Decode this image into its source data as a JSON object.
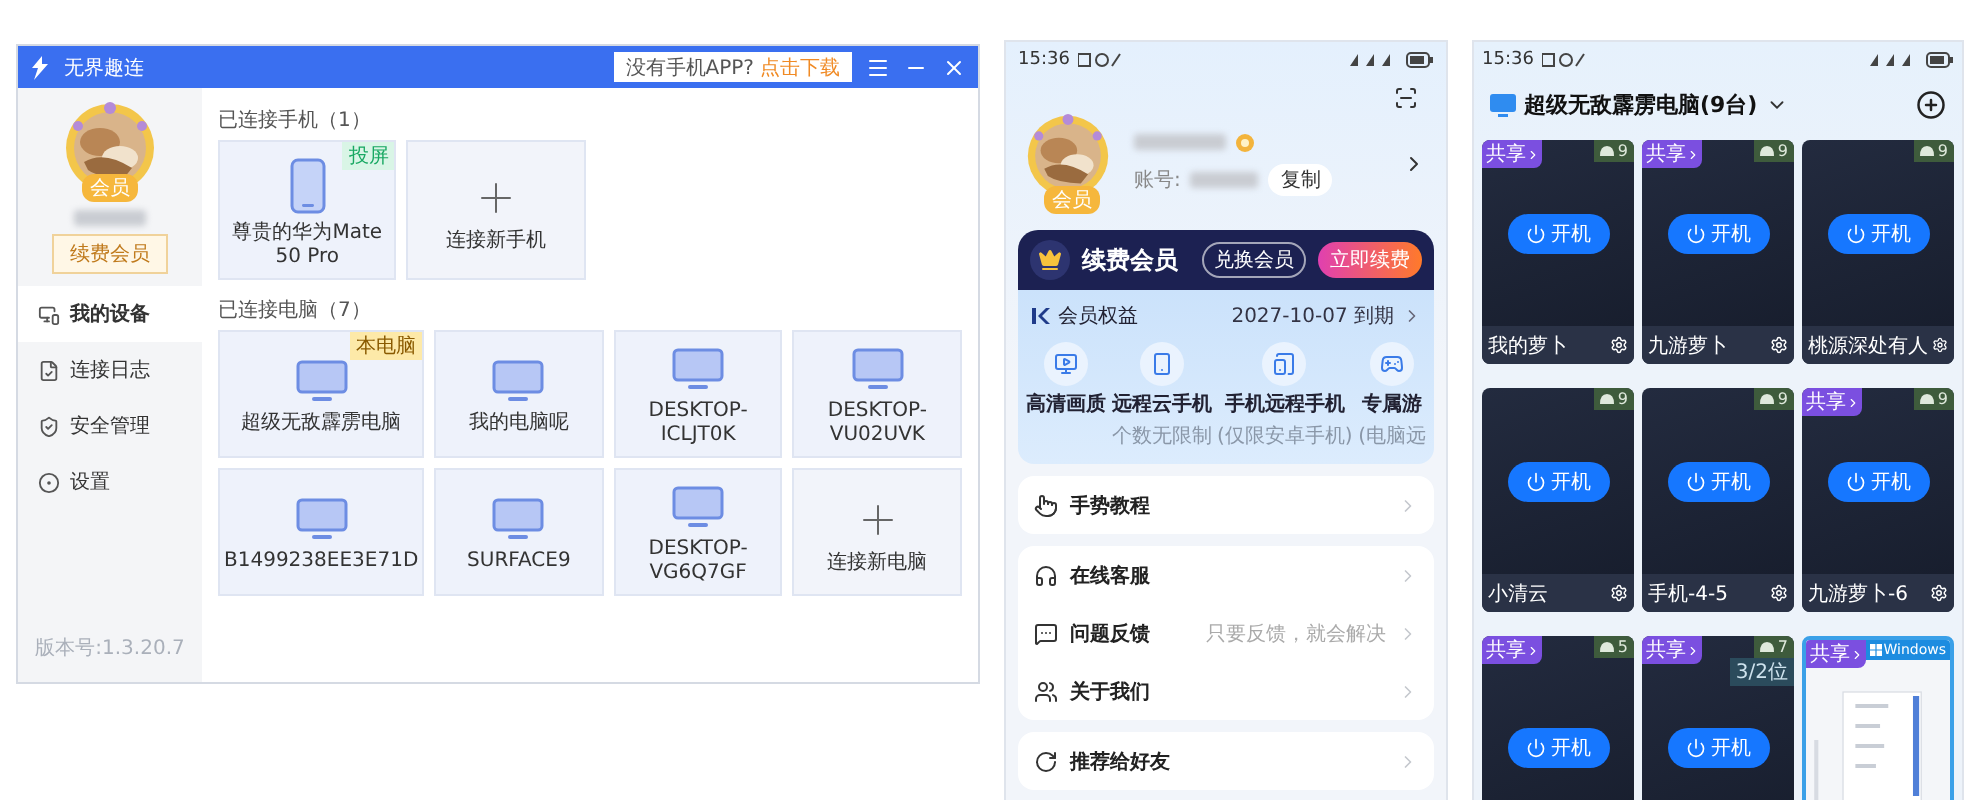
{
  "desktop_app": {
    "title": "无界趣连",
    "download_prompt": "没有手机APP?",
    "download_link": "点击下载",
    "member_badge": "会员",
    "renew_button": "续费会员",
    "nav": [
      {
        "label": "我的设备",
        "selected": true
      },
      {
        "label": "连接日志",
        "selected": false
      },
      {
        "label": "安全管理",
        "selected": false
      },
      {
        "label": "设置",
        "selected": false
      }
    ],
    "version": "版本号:1.3.20.7",
    "sections": [
      {
        "title": "已连接手机（1）",
        "devices": [
          {
            "kind": "phone",
            "name": "尊贵的华为Mate 50 Pro",
            "tag": {
              "kind": "cast",
              "text": "投屏"
            }
          },
          {
            "kind": "add",
            "name": "连接新手机"
          }
        ]
      },
      {
        "title": "已连接电脑（7）",
        "devices": [
          {
            "kind": "computer",
            "name": "超级无敌霹雳电脑",
            "tag": {
              "kind": "local",
              "text": "本电脑"
            }
          },
          {
            "kind": "computer",
            "name": "我的电脑呢"
          },
          {
            "kind": "computer",
            "name": "DESKTOP-ICLJT0K"
          },
          {
            "kind": "computer",
            "name": "DESKTOP-VU02UVK"
          },
          {
            "kind": "computer",
            "name": "B1499238EE3E71D"
          },
          {
            "kind": "computer",
            "name": "SURFACE9"
          },
          {
            "kind": "computer",
            "name": "DESKTOP-VG6Q7GF"
          },
          {
            "kind": "add",
            "name": "连接新电脑"
          }
        ]
      }
    ]
  },
  "member_phone": {
    "status_time": "15:36",
    "member_badge": "会员",
    "account_label": "账号:",
    "copy_button": "复制",
    "renew_title": "续费会员",
    "redeem_button": "兑换会员",
    "renew_now_button": "立即续费",
    "benefits_title": "会员权益",
    "expiry": "2027-10-07 到期",
    "benefits": [
      {
        "title": "高清画质"
      },
      {
        "title": "远程云手机",
        "subtitle": "个数无限制"
      },
      {
        "title": "手机远程手机",
        "subtitle": "(仅限安卓手机)"
      },
      {
        "title": "专属游",
        "subtitle": "(电脑远"
      }
    ],
    "menu_groups": [
      {
        "items": [
          {
            "label": "手势教程"
          }
        ]
      },
      {
        "items": [
          {
            "label": "在线客服"
          },
          {
            "label": "问题反馈",
            "hint": "只要反馈，就会解决"
          },
          {
            "label": "关于我们"
          }
        ]
      },
      {
        "items": [
          {
            "label": "推荐给好友"
          }
        ]
      }
    ]
  },
  "devices_phone": {
    "status_time": "15:36",
    "title": "超级无敌霹雳电脑(9台)",
    "tiles": [
      {
        "kind": "device",
        "shared_tag": "共享",
        "count": "9",
        "power_button": "开机",
        "name": "我的萝卜"
      },
      {
        "kind": "device",
        "shared_tag": "共享",
        "count": "9",
        "power_button": "开机",
        "name": "九游萝卜"
      },
      {
        "kind": "device",
        "count": "9",
        "power_button": "开机",
        "name": "桃源深处有人"
      },
      {
        "kind": "device",
        "count": "9",
        "power_button": "开机",
        "name": "小清云"
      },
      {
        "kind": "device",
        "count": "9",
        "power_button": "开机",
        "name": "手机-4-5"
      },
      {
        "kind": "device",
        "shared_tag": "共享",
        "count": "9",
        "power_button": "开机",
        "name": "九游萝卜-6"
      },
      {
        "kind": "device",
        "shared_tag": "共享",
        "count": "5",
        "power_button": "开机"
      },
      {
        "kind": "device",
        "shared_tag": "共享",
        "count": "7",
        "seats": "3/2位",
        "power_button": "开机"
      },
      {
        "kind": "windows",
        "shared_tag": "共享",
        "os_label": "Windows"
      }
    ]
  }
}
